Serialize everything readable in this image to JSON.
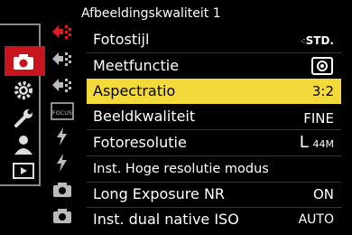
{
  "header": {
    "title": "Afbeeldingskwaliteit 1"
  },
  "categories": [
    {
      "name": "camera-icon",
      "selected": true
    },
    {
      "name": "gear-icon",
      "selected": false
    },
    {
      "name": "wrench-icon",
      "selected": false
    },
    {
      "name": "person-icon",
      "selected": false
    },
    {
      "name": "playback-icon",
      "selected": false
    }
  ],
  "submenu_icons": [
    {
      "name": "page-red-arrow-icon"
    },
    {
      "name": "page-arrow-icon"
    },
    {
      "name": "page-arrow-icon"
    },
    {
      "name": "focus-icon",
      "text": "FOCUS"
    },
    {
      "name": "flash-icon"
    },
    {
      "name": "flash-icon"
    },
    {
      "name": "camera-small-icon"
    },
    {
      "name": "camera-small-icon"
    }
  ],
  "menu": {
    "items": [
      {
        "label": "Fotostijl",
        "value": "STD."
      },
      {
        "label": "Meetfunctie",
        "value": ""
      },
      {
        "label": "Aspectratio",
        "value": "3:2"
      },
      {
        "label": "Beeldkwaliteit",
        "value": "FINE"
      },
      {
        "label": "Fotoresolutie",
        "value": "L",
        "value_sub": "44M"
      },
      {
        "label": "Inst. Hoge resolutie modus",
        "value": ""
      },
      {
        "label": "Long Exposure NR",
        "value": "ON"
      },
      {
        "label": "Inst. dual native ISO",
        "value": "AUTO"
      }
    ]
  },
  "colors": {
    "selected_row": "#f4d93a",
    "selected_category": "#c8141c"
  }
}
